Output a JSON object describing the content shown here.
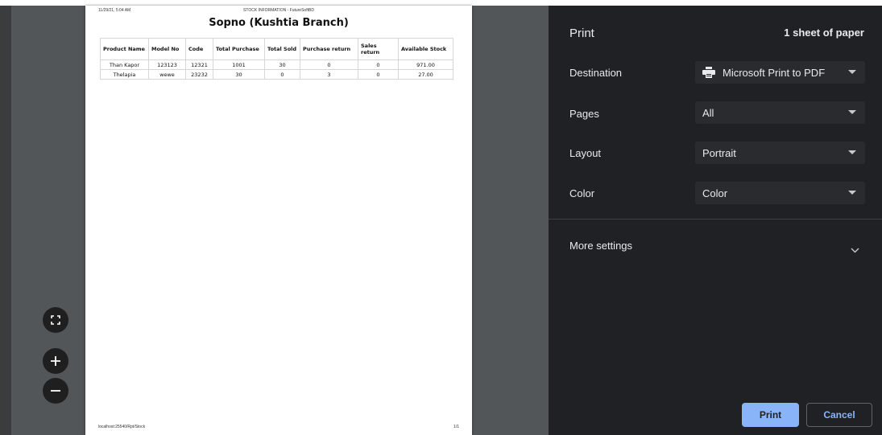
{
  "preview": {
    "page_date": "11/29/21, 5:04 AM",
    "page_header": "STOCK INFORMATION - FutureSoftBD",
    "page_title": "Sopno (Kushtia Branch)",
    "table": {
      "headers": [
        "Product Name",
        "Model No",
        "Code",
        "Total Purchase",
        "Total Sold",
        "Purchase return",
        "Sales return",
        "Available Stock"
      ],
      "rows": [
        [
          "Than Kapor",
          "123123",
          "12321",
          "1001",
          "30",
          "0",
          "0",
          "971.00"
        ],
        [
          "Thelapia",
          "wewe",
          "23232",
          "30",
          "0",
          "3",
          "0",
          "27.00"
        ]
      ]
    },
    "page_footer_url": "localhost:25540/Rpt/Stock",
    "page_footer_page": "1/1",
    "controls": {
      "fit_icon": "fit-to-page-icon",
      "zoom_in_icon": "zoom-in-icon",
      "zoom_out_icon": "zoom-out-icon"
    }
  },
  "panel": {
    "title": "Print",
    "sheet_count": "1 sheet of paper",
    "destination": {
      "label": "Destination",
      "value": "Microsoft Print to PDF",
      "icon": "printer-icon"
    },
    "pages": {
      "label": "Pages",
      "value": "All"
    },
    "layout": {
      "label": "Layout",
      "value": "Portrait"
    },
    "color": {
      "label": "Color",
      "value": "Color"
    },
    "more_settings": "More settings",
    "print_button": "Print",
    "cancel_button": "Cancel"
  },
  "colors": {
    "panel_bg": "#202124",
    "preview_bg": "#525659",
    "accent": "#8ab4f8"
  }
}
